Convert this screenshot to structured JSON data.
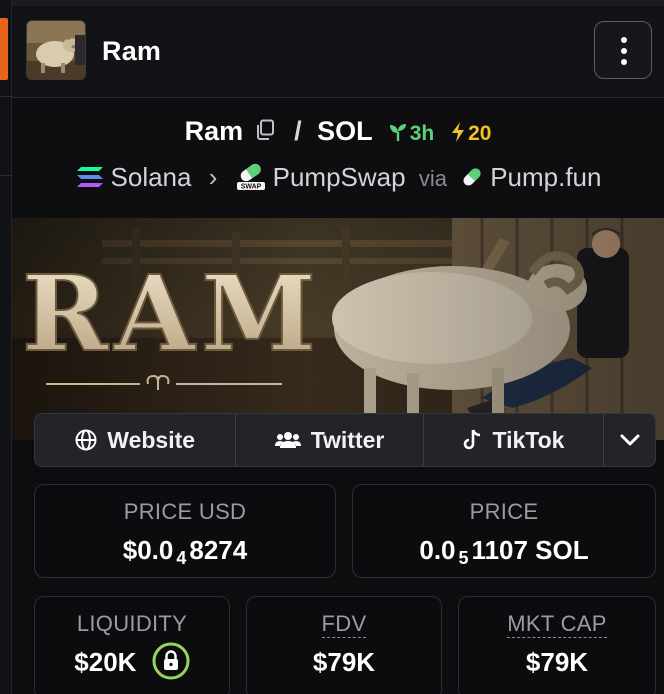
{
  "token": {
    "name": "Ram"
  },
  "pair": {
    "base": "Ram",
    "separator": "/",
    "quote": "SOL",
    "age": "3h",
    "boosts": "20"
  },
  "route": {
    "chain": "Solana",
    "dex": "PumpSwap",
    "via_label": "via",
    "launchpad": "Pump.fun",
    "dex_badge": "SWAP"
  },
  "banner": {
    "text": "RAM"
  },
  "links": {
    "website": "Website",
    "twitter": "Twitter",
    "tiktok": "TikTok"
  },
  "stats": {
    "price_usd": {
      "label": "PRICE USD",
      "prefix": "$0.0",
      "sub": "4",
      "suffix": "8274"
    },
    "price": {
      "label": "PRICE",
      "prefix": "0.0",
      "sub": "5",
      "suffix": "1107 SOL"
    },
    "liquidity": {
      "label": "LIQUIDITY",
      "value": "$20K"
    },
    "fdv": {
      "label": "FDV",
      "value": "$79K"
    },
    "mkt_cap": {
      "label": "MKT CAP",
      "value": "$79K"
    }
  },
  "colors": {
    "accent": "#e8641b",
    "age_green": "#5dd17a",
    "boost_yellow": "#f3c125",
    "lock_ring": "#9ad35a"
  },
  "icons": [
    "copy-icon",
    "seedling-icon",
    "lightning-icon",
    "solana-icon",
    "pumpswap-icon",
    "pill-icon",
    "globe-icon",
    "users-icon",
    "tiktok-icon",
    "chevron-down-icon",
    "kebab-menu-icon",
    "lock-icon"
  ]
}
